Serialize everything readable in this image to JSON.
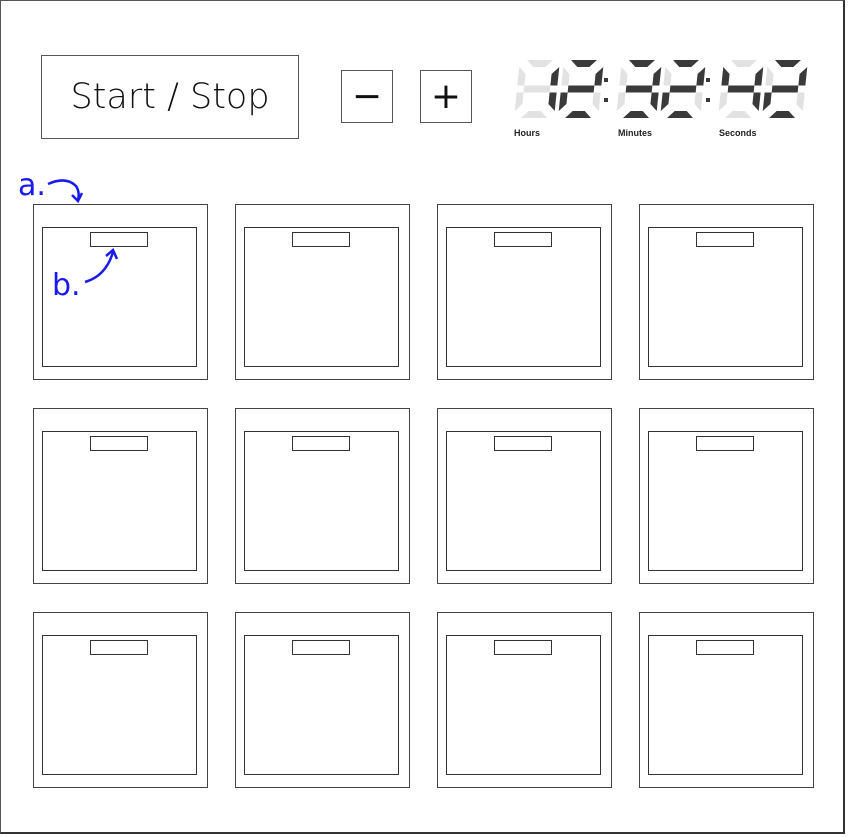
{
  "controls": {
    "start_stop_label": "Start / Stop",
    "decrement_label": "−",
    "increment_label": "+"
  },
  "clock": {
    "hours": "12",
    "minutes": "32",
    "seconds": "42",
    "separator": ":",
    "labels": {
      "hours": "Hours",
      "minutes": "Minutes",
      "seconds": "Seconds"
    },
    "lit_color": "#3a3a3a",
    "unlit_color": "#e2e2e2"
  },
  "grid": {
    "rows": 3,
    "columns": 4
  },
  "annotations": {
    "a": "a.",
    "b": "b.",
    "color": "#1a1aee"
  }
}
